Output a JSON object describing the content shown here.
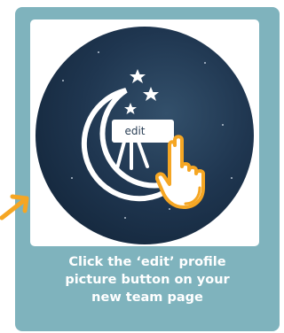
{
  "avatar": {
    "edit_label": "edit"
  },
  "caption": {
    "line1": "Click the ‘edit’ profile",
    "line2": "picture button on your",
    "line3": "new team page"
  },
  "colors": {
    "card_background": "#7fb3bd",
    "accent_orange": "#f5a623",
    "night_sky": "#1f3650"
  },
  "icons": {
    "pointer": "hand-pointer-icon",
    "arrow": "arrow-icon",
    "logo": "moon-telescope-logo"
  }
}
